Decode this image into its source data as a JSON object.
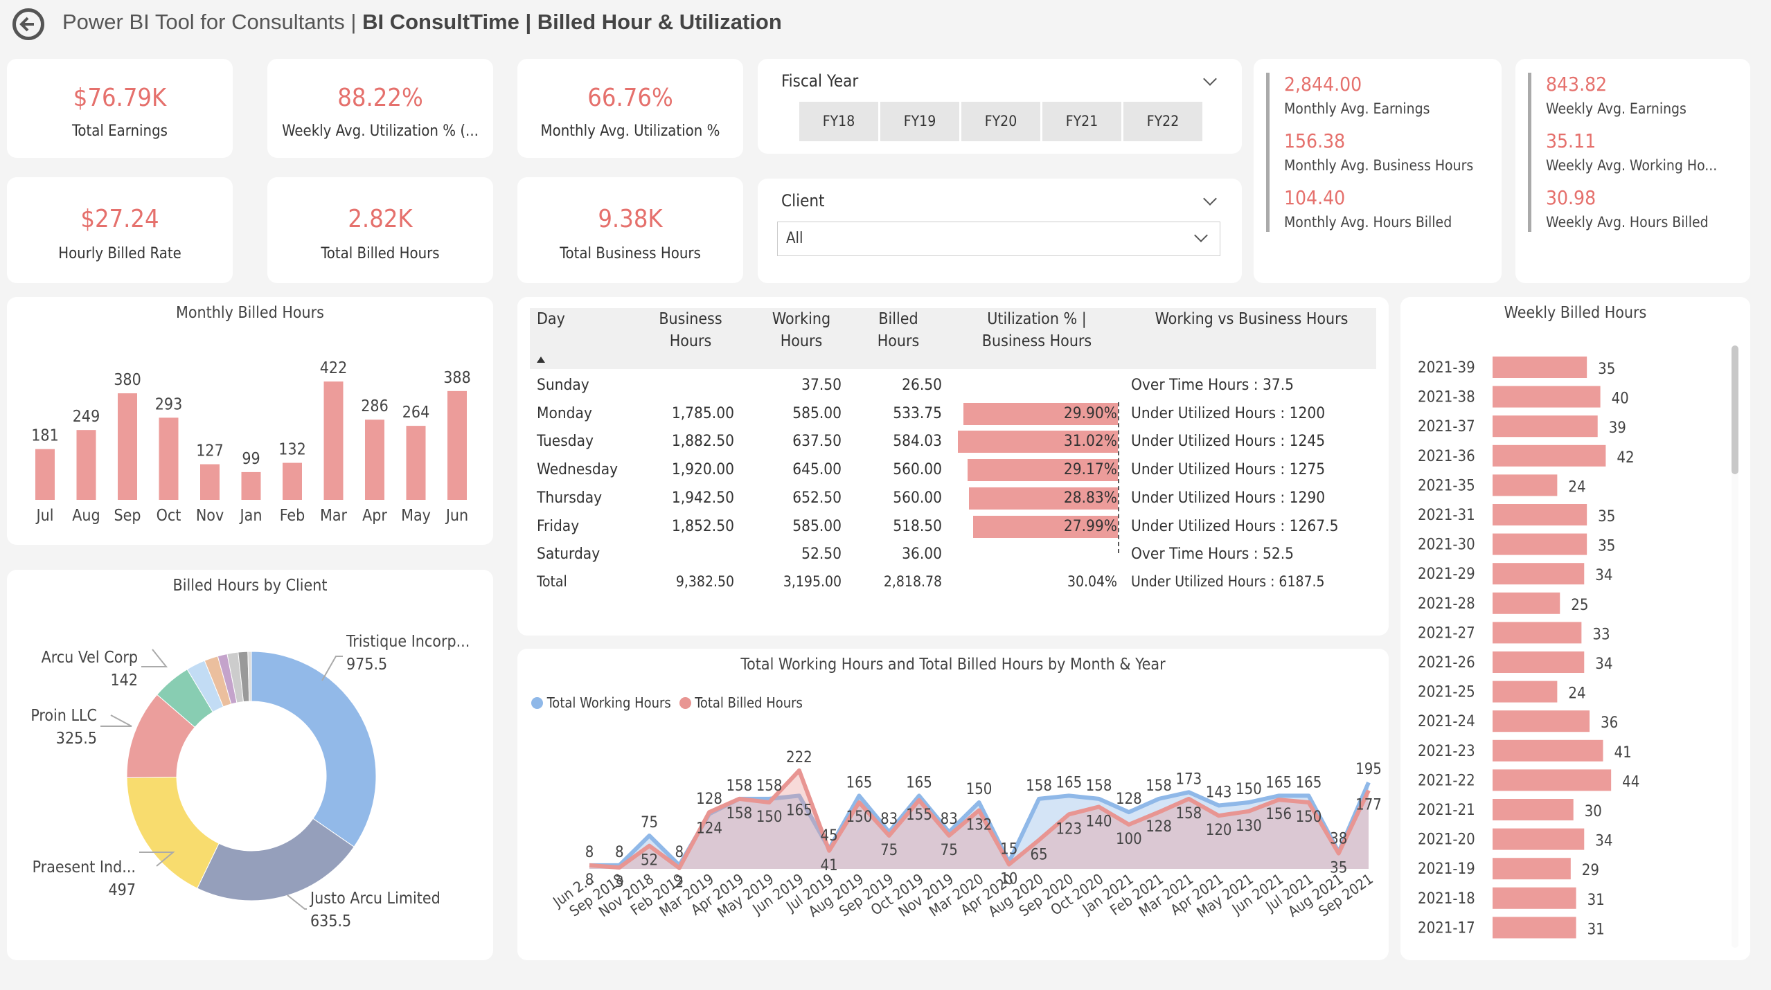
{
  "header": {
    "title_light": "Power BI Tool for Consultants | ",
    "title_bold": "BI ConsultTime | Billed Hour & Utilization",
    "back_icon": "back-arrow-icon"
  },
  "kpis": [
    {
      "value": "$76.79K",
      "label": "Total Earnings"
    },
    {
      "value": "88.22%",
      "label": "Weekly Avg. Utilization % (..."
    },
    {
      "value": "66.76%",
      "label": "Monthly Avg. Utilization %"
    },
    {
      "value": "$27.24",
      "label": "Hourly Billed Rate"
    },
    {
      "value": "2.82K",
      "label": "Total Billed Hours"
    },
    {
      "value": "9.38K",
      "label": "Total Business Hours"
    }
  ],
  "fiscal_year": {
    "label": "Fiscal Year",
    "options": [
      "FY18",
      "FY19",
      "FY20",
      "FY21",
      "FY22"
    ]
  },
  "client": {
    "label": "Client",
    "selected": "All"
  },
  "monthly_avg": [
    {
      "value": "2,844.00",
      "label": "Monthly Avg. Earnings"
    },
    {
      "value": "156.38",
      "label": "Monthly Avg. Business Hours"
    },
    {
      "value": "104.40",
      "label": "Monthly Avg. Hours Billed"
    }
  ],
  "weekly_avg": [
    {
      "value": "843.82",
      "label": "Weekly Avg. Earnings"
    },
    {
      "value": "35.11",
      "label": "Weekly Avg. Working Ho..."
    },
    {
      "value": "30.98",
      "label": "Weekly Avg. Hours Billed"
    }
  ],
  "colors": {
    "accent": "#e5706c",
    "bar": "#ec9c9a",
    "working": "#8fb8e8",
    "billed": "#e89592"
  },
  "table": {
    "headers": [
      "Day",
      "Business\nHours",
      "Working\nHours",
      "Billed\nHours",
      "Utilization % |\nBusiness Hours",
      "Working vs Business Hours"
    ],
    "sort_icon": "sort-ascending-icon",
    "rows": [
      {
        "day": "Sunday",
        "business": "",
        "working": "37.50",
        "billed": "26.50",
        "util": "",
        "util_value": null,
        "status": "Over Time Hours : 37.5"
      },
      {
        "day": "Monday",
        "business": "1,785.00",
        "working": "585.00",
        "billed": "533.75",
        "util": "29.90%",
        "util_value": 29.9,
        "status": "Under Utilized Hours : 1200"
      },
      {
        "day": "Tuesday",
        "business": "1,882.50",
        "working": "637.50",
        "billed": "584.03",
        "util": "31.02%",
        "util_value": 31.02,
        "status": "Under Utilized Hours : 1245"
      },
      {
        "day": "Wednesday",
        "business": "1,920.00",
        "working": "645.00",
        "billed": "560.00",
        "util": "29.17%",
        "util_value": 29.17,
        "status": "Under Utilized Hours : 1275"
      },
      {
        "day": "Thursday",
        "business": "1,942.50",
        "working": "652.50",
        "billed": "560.00",
        "util": "28.83%",
        "util_value": 28.83,
        "status": "Under Utilized Hours : 1290"
      },
      {
        "day": "Friday",
        "business": "1,852.50",
        "working": "585.00",
        "billed": "518.50",
        "util": "27.99%",
        "util_value": 27.99,
        "status": "Under Utilized Hours : 1267.5"
      },
      {
        "day": "Saturday",
        "business": "",
        "working": "52.50",
        "billed": "36.00",
        "util": "",
        "util_value": null,
        "status": "Over Time Hours : 52.5"
      }
    ],
    "total": {
      "day": "Total",
      "business": "9,382.50",
      "working": "3,195.00",
      "billed": "2,818.78",
      "util": "30.04%",
      "status": "Under Utilized Hours : 6187.5"
    }
  },
  "chart_data": [
    {
      "type": "bar",
      "title": "Monthly Billed Hours",
      "categories": [
        "Jul",
        "Aug",
        "Sep",
        "Oct",
        "Nov",
        "Jan",
        "Feb",
        "Mar",
        "Apr",
        "May",
        "Jun"
      ],
      "values": [
        181,
        249,
        380,
        293,
        127,
        99,
        132,
        422,
        286,
        264,
        388
      ]
    },
    {
      "type": "pie",
      "title": "Billed Hours by Client",
      "donut": true,
      "slices": [
        {
          "name": "Tristique Incorp...",
          "value": 975.5,
          "color": "#92b9e8"
        },
        {
          "name": "Justo Arcu Limited",
          "value": 635.5,
          "color": "#959fbb"
        },
        {
          "name": "Praesent Ind...",
          "value": 497,
          "color": "#f8dc6e"
        },
        {
          "name": "Proin LLC",
          "value": 325.5,
          "color": "#eb9e9c"
        },
        {
          "name": "Arcu Vel Corp",
          "value": 142,
          "color": "#88cdb2"
        },
        {
          "value": 70,
          "color": "#c2dcf4"
        },
        {
          "value": 50,
          "color": "#ebbf9e"
        },
        {
          "value": 35,
          "color": "#c4a3cb"
        },
        {
          "value": 40,
          "color": "#cccccc"
        },
        {
          "value": 35,
          "color": "#999999"
        },
        {
          "value": 13,
          "color": "#dddddd"
        }
      ]
    },
    {
      "type": "area",
      "title": "Total Working Hours and Total Billed Hours by Month & Year",
      "legend": "top-left",
      "x": [
        "Jun 2...",
        "Sep 2018",
        "Nov 2018",
        "Feb 2019",
        "Mar 2019",
        "Apr 2019",
        "May 2019",
        "Jun 2019",
        "Jul 2019",
        "Aug 2019",
        "Sep 2019",
        "Oct 2019",
        "Nov 2019",
        "Mar 2020",
        "Apr 2020",
        "Aug 2020",
        "Sep 2020",
        "Oct 2020",
        "Jan 2021",
        "Feb 2021",
        "Mar 2021",
        "Apr 2021",
        "May 2021",
        "Jun 2021",
        "Jul 2021",
        "Aug 2021",
        "Sep 2021"
      ],
      "series": [
        {
          "name": "Total Working Hours",
          "color": "#8fb8e8",
          "values": [
            8,
            8,
            75,
            8,
            124,
            158,
            158,
            165,
            45,
            165,
            83,
            165,
            83,
            150,
            15,
            158,
            165,
            158,
            128,
            158,
            173,
            143,
            150,
            165,
            165,
            38,
            195
          ]
        },
        {
          "name": "Total Billed Hours",
          "color": "#e89592",
          "values": [
            8,
            3,
            52,
            2,
            128,
            158,
            150,
            222,
            41,
            150,
            75,
            155,
            75,
            132,
            10,
            65,
            123,
            140,
            100,
            128,
            158,
            120,
            130,
            156,
            150,
            35,
            177
          ]
        }
      ]
    },
    {
      "type": "bar",
      "orientation": "horizontal",
      "title": "Weekly Billed Hours",
      "categories": [
        "2021-39",
        "2021-38",
        "2021-37",
        "2021-36",
        "2021-35",
        "2021-31",
        "2021-30",
        "2021-29",
        "2021-28",
        "2021-27",
        "2021-26",
        "2021-25",
        "2021-24",
        "2021-23",
        "2021-22",
        "2021-21",
        "2021-20",
        "2021-19",
        "2021-18",
        "2021-17"
      ],
      "values": [
        35,
        40,
        39,
        42,
        24,
        35,
        35,
        34,
        25,
        33,
        34,
        24,
        36,
        41,
        44,
        30,
        34,
        29,
        31,
        31
      ]
    }
  ]
}
